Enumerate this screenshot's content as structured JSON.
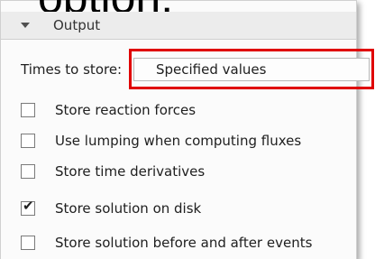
{
  "caption": "option.",
  "section": {
    "title": "Output",
    "expanded": true
  },
  "times_to_store": {
    "label": "Times to store:",
    "selected": "Specified values"
  },
  "checkboxes": [
    {
      "label": "Store reaction forces",
      "checked": false
    },
    {
      "label": "Use lumping when computing fluxes",
      "checked": false
    },
    {
      "label": "Store time derivatives",
      "checked": false
    },
    {
      "label": "Store solution on disk",
      "checked": true
    },
    {
      "label": "Store solution before and after events",
      "checked": false
    }
  ],
  "colors": {
    "highlight": "#e00000",
    "panel_bg": "#fbfbfb",
    "header_bg": "#ececec"
  },
  "icons": {
    "section_toggle": "chevron-down-icon",
    "checkmark": "checkmark-icon"
  }
}
